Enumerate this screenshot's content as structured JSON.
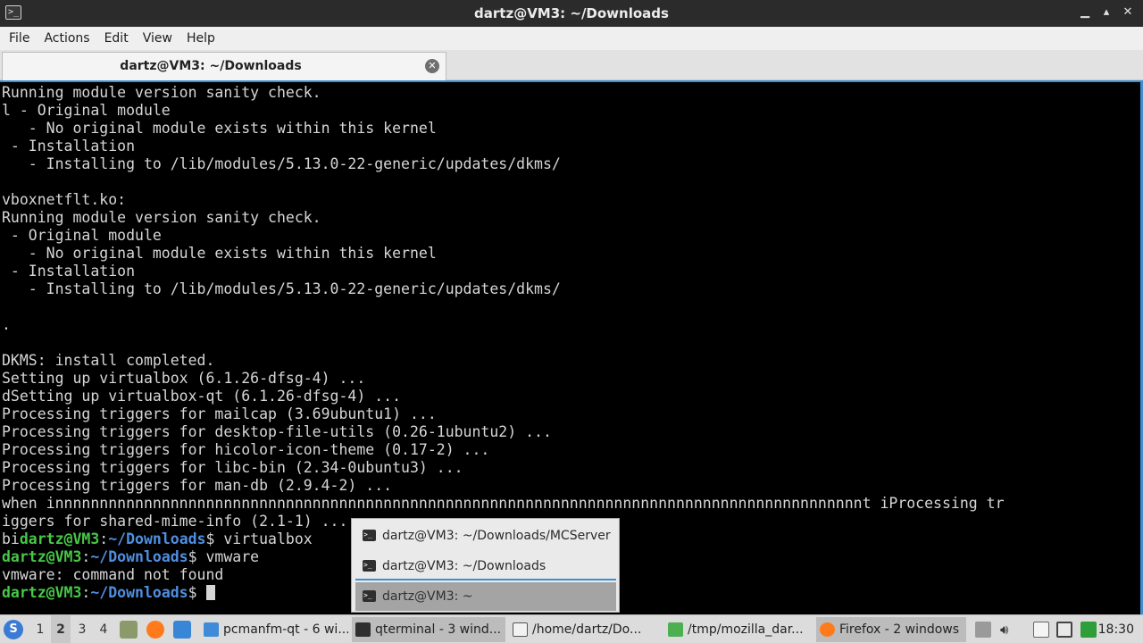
{
  "window": {
    "title": "dartz@VM3: ~/Downloads",
    "app_icon": "terminal-icon",
    "controls": [
      "minimize-icon",
      "maximize-icon",
      "close-icon"
    ]
  },
  "menubar": {
    "items": [
      "File",
      "Actions",
      "Edit",
      "View",
      "Help"
    ]
  },
  "tabs": [
    {
      "label": "dartz@VM3: ~/Downloads",
      "close_icon": "close-circle-icon"
    }
  ],
  "terminal": {
    "lines": [
      "Running module version sanity check.",
      "l - Original module",
      "   - No original module exists within this kernel",
      " - Installation",
      "   - Installing to /lib/modules/5.13.0-22-generic/updates/dkms/",
      "",
      "vboxnetflt.ko:",
      "Running module version sanity check.",
      " - Original module",
      "   - No original module exists within this kernel",
      " - Installation",
      "   - Installing to /lib/modules/5.13.0-22-generic/updates/dkms/",
      "",
      ".",
      "",
      "DKMS: install completed.",
      "Setting up virtualbox (6.1.26-dfsg-4) ...",
      "dSetting up virtualbox-qt (6.1.26-dfsg-4) ...",
      "Processing triggers for mailcap (3.69ubuntu1) ...",
      "Processing triggers for desktop-file-utils (0.26-1ubuntu2) ...",
      "Processing triggers for hicolor-icon-theme (0.17-2) ...",
      "Processing triggers for libc-bin (2.34-0ubuntu3) ...",
      "Processing triggers for man-db (2.9.4-2) ...",
      "when innnnnnnnnnnnnnnnnnnnnnnnnnnnnnnnnnnnnnnnnnnnnnnnnnnnnnnnnnnnnnnnnnnnnnnnnnnnnnnnnnnnnnnnnnnt iProcessing tr",
      "iggers for shared-mime-info (2.1-1) ..."
    ],
    "prompt_lines": [
      {
        "prefix": "bi",
        "user": "dartz@VM3",
        "sep": ":",
        "path": "~/Downloads",
        "symbol": "$ ",
        "command": "virtualbox"
      },
      {
        "prefix": "",
        "user": "dartz@VM3",
        "sep": ":",
        "path": "~/Downloads",
        "symbol": "$ ",
        "command": "vmware"
      }
    ],
    "error_line": "vmware: command not found",
    "current_prompt": {
      "user": "dartz@VM3",
      "sep": ":",
      "path": "~/Downloads",
      "symbol": "$ "
    }
  },
  "window_popup": {
    "items": [
      {
        "label": "dartz@VM3: ~/Downloads/MCServer",
        "icon": "terminal-icon"
      },
      {
        "label": "dartz@VM3: ~/Downloads",
        "icon": "terminal-icon"
      },
      {
        "label": "dartz@VM3: ~",
        "icon": "terminal-icon"
      }
    ]
  },
  "taskbar": {
    "start_icon": "start-menu-icon",
    "workspaces": [
      "1",
      "2",
      "3",
      "4"
    ],
    "current_workspace": "2",
    "quicklaunch": [
      "file-manager-icon",
      "firefox-icon",
      "desktop-icon"
    ],
    "tasks": [
      {
        "label": "pcmanfm-qt - 6 wi...",
        "icon": "folder-icon"
      },
      {
        "label": "qterminal - 3 wind...",
        "icon": "terminal-icon"
      },
      {
        "label": "/home/dartz/Do...",
        "icon": "text-editor-icon"
      },
      {
        "label": "/tmp/mozilla_dar...",
        "icon": "archive-icon"
      },
      {
        "label": "Firefox - 2 windows",
        "icon": "firefox-icon"
      }
    ],
    "tray": [
      "clipboard-icon",
      "volume-icon",
      "file-icon",
      "network-icon",
      "updates-icon"
    ],
    "clock": "18:30",
    "colors": {
      "accent": "#3d8fd1",
      "prompt_user": "#46c846",
      "prompt_path": "#4f8fe0"
    }
  }
}
